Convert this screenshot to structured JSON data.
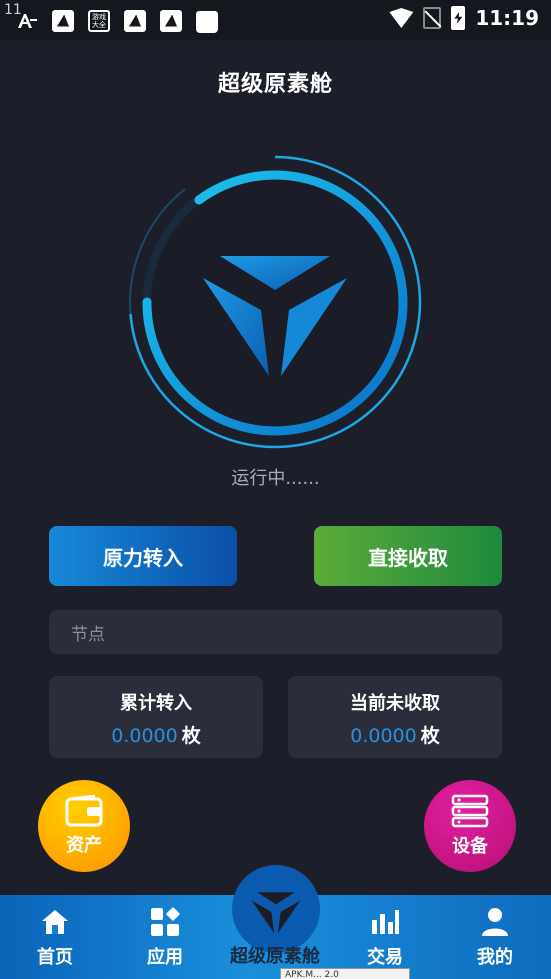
{
  "status_bar": {
    "corner_text": "11",
    "time": "11:19",
    "game_icon_text": "游戏大全"
  },
  "page": {
    "title": "超级原素舱",
    "status": "运行中......"
  },
  "actions": {
    "transfer_label": "原力转入",
    "collect_label": "直接收取"
  },
  "node_field": {
    "placeholder": "节点"
  },
  "stats": [
    {
      "label": "累计转入",
      "value": "0.0000",
      "unit": "枚"
    },
    {
      "label": "当前未收取",
      "value": "0.0000",
      "unit": "枚"
    }
  ],
  "fabs": {
    "assets_label": "资产",
    "devices_label": "设备"
  },
  "nav": {
    "items": [
      {
        "label": "首页",
        "icon": "home-icon"
      },
      {
        "label": "应用",
        "icon": "apps-icon"
      },
      {
        "label": "超级原素舱",
        "icon": "logo-icon"
      },
      {
        "label": "交易",
        "icon": "chart-icon"
      },
      {
        "label": "我的",
        "icon": "user-icon"
      }
    ]
  },
  "apk_tag": "APK.M...    2.0",
  "colors": {
    "background": "#1c1f2a",
    "accent_blue": "#1a8fdc",
    "accent_green": "#3a9c3d",
    "value_blue": "#2b8fe0",
    "assets_orange": "#ffa400",
    "devices_magenta": "#c41482"
  }
}
